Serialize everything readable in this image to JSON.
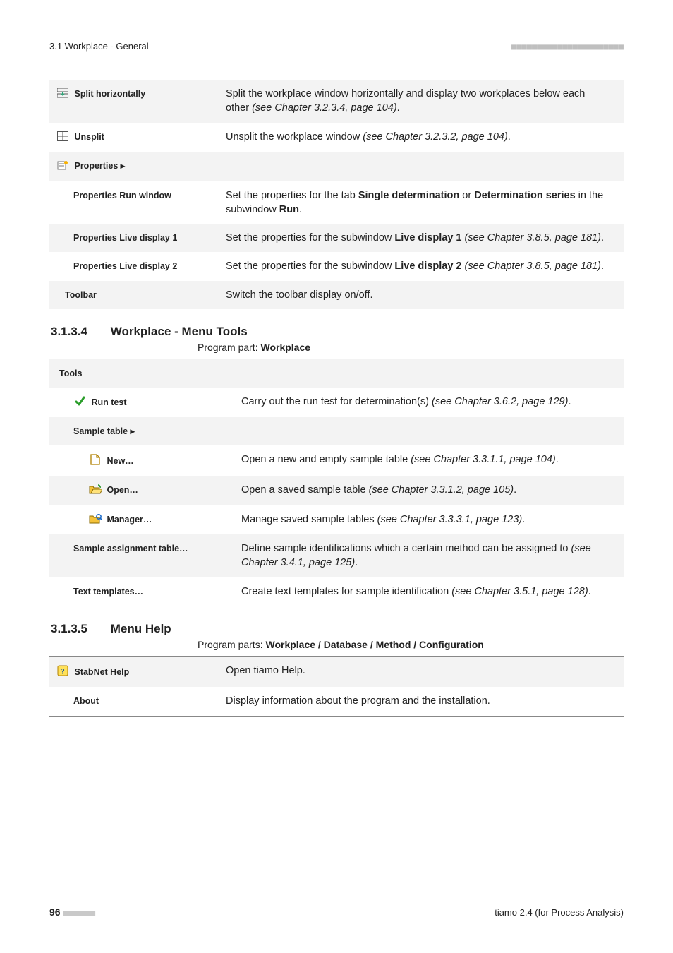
{
  "header": {
    "breadcrumb": "3.1 Workplace - General",
    "dashes": "■■■■■■■■■■■■■■■■■■■■■■"
  },
  "table1": {
    "split_h": {
      "label": "Split horizontally",
      "desc_pre": "Split the workplace window horizontally and display two workplaces below each other ",
      "desc_ital": "(see Chapter 3.2.3.4, page 104)",
      "desc_post": "."
    },
    "unsplit": {
      "label": "Unsplit",
      "desc_pre": "Unsplit the workplace window ",
      "desc_ital": "(see Chapter 3.2.3.2, page 104)",
      "desc_post": "."
    },
    "properties": {
      "label": "Properties ▸"
    },
    "prop_run": {
      "label": "Properties Run window",
      "d1": "Set the properties for the tab ",
      "b1": "Single determination",
      "d2": " or ",
      "b2": "Determination series",
      "d3": " in the subwindow ",
      "b3": "Run",
      "d4": "."
    },
    "prop_ld1": {
      "label": "Properties Live display 1",
      "d1": "Set the properties for the subwindow ",
      "b1": "Live display 1",
      "d2": " ",
      "i1": "(see Chapter 3.8.5, page 181)",
      "d3": "."
    },
    "prop_ld2": {
      "label": "Properties Live display 2",
      "d1": "Set the properties for the subwindow ",
      "b1": "Live display 2",
      "d2": " ",
      "i1": "(see Chapter 3.8.5, page 181)",
      "d3": "."
    },
    "toolbar": {
      "label": "Toolbar",
      "desc": "Switch the toolbar display on/off."
    }
  },
  "sec1": {
    "num": "3.1.3.4",
    "title": "Workplace - Menu Tools",
    "pp_prefix": "Program part: ",
    "pp_bold": "Workplace"
  },
  "table2": {
    "tools": {
      "label": "Tools"
    },
    "runtest": {
      "label": "Run test",
      "d1": "Carry out the run test for determination(s) ",
      "i1": "(see Chapter 3.6.2, page 129)",
      "d2": "."
    },
    "sampletable": {
      "label": "Sample table ▸"
    },
    "new": {
      "label": "New…",
      "d1": "Open a new and empty sample table ",
      "i1": "(see Chapter 3.3.1.1, page 104)",
      "d2": "."
    },
    "open": {
      "label": "Open…",
      "d1": "Open a saved sample table ",
      "i1": "(see Chapter 3.3.1.2, page 105)",
      "d2": "."
    },
    "manager": {
      "label": "Manager…",
      "d1": "Manage saved sample tables ",
      "i1": "(see Chapter 3.3.3.1, page 123)",
      "d2": "."
    },
    "assign": {
      "label": "Sample assignment table…",
      "d1": "Define sample identifications which a certain method can be assigned to ",
      "i1": "(see Chapter 3.4.1, page 125)",
      "d2": "."
    },
    "templates": {
      "label": "Text templates…",
      "d1": "Create text templates for sample identification ",
      "i1": "(see Chapter 3.5.1, page 128)",
      "d2": "."
    }
  },
  "sec2": {
    "num": "3.1.3.5",
    "title": "Menu Help",
    "pp_prefix": "Program parts: ",
    "pp_bold": "Workplace / Database / Method / Configuration"
  },
  "table3": {
    "help": {
      "label": "StabNet Help",
      "desc": "Open tiamo Help."
    },
    "about": {
      "label": "About",
      "desc": "Display information about the program and the installation."
    }
  },
  "footer": {
    "page": "96",
    "dashes": "■■■■■■■■",
    "right": "tiamo 2.4 (for Process Analysis)"
  }
}
